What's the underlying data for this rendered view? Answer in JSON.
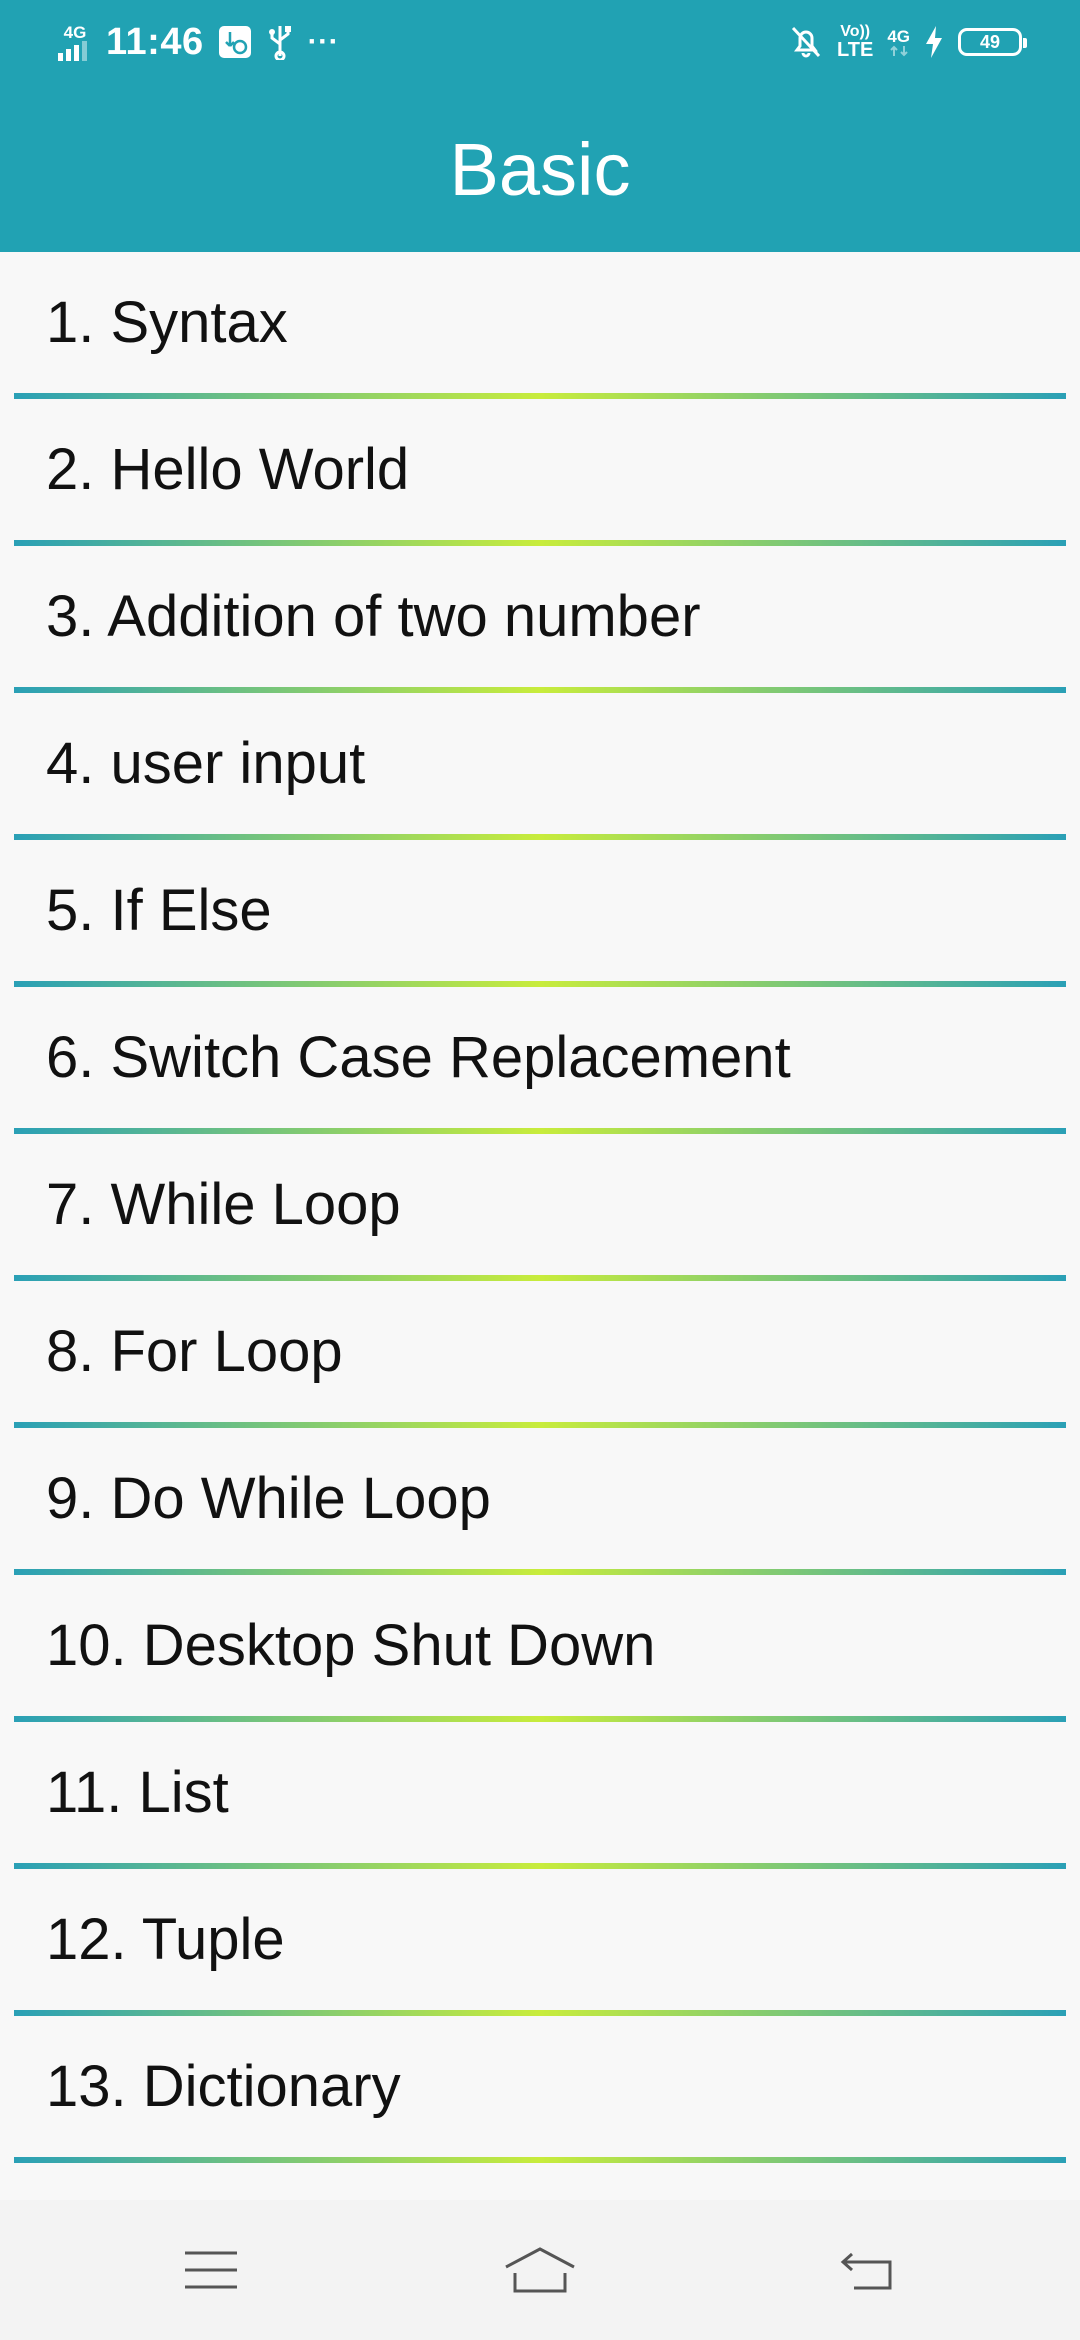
{
  "status_bar": {
    "network_left": "4G",
    "time": "11:46",
    "more": "···",
    "volte_top": "Vo))",
    "volte_bottom": "LTE",
    "network_right": "4G",
    "battery_level": "49"
  },
  "header": {
    "title": "Basic",
    "color": "#21a2b3"
  },
  "list": {
    "items": [
      "1. Syntax",
      "2. Hello World",
      "3. Addition of two number",
      "4. user input",
      "5. If Else",
      "6. Switch Case Replacement",
      "7. While Loop",
      "8. For Loop",
      "9. Do While Loop",
      "10. Desktop Shut Down",
      "11. List",
      "12. Tuple",
      "13. Dictionary"
    ]
  },
  "nav_bar": {
    "icons": [
      "menu-icon",
      "home-icon",
      "back-icon"
    ]
  }
}
